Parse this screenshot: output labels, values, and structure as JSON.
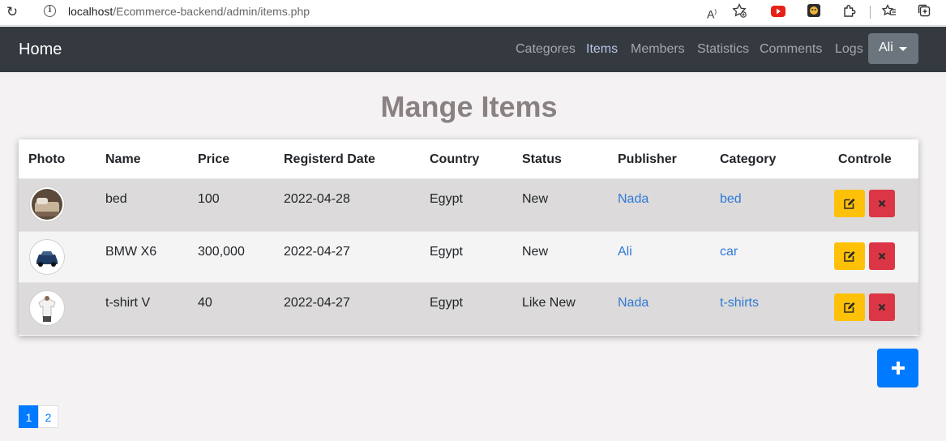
{
  "browser": {
    "url_host": "localhost",
    "url_path": "/Ecommerce-backend/admin/items.php",
    "read_aloud_label": "A",
    "read_aloud_sup": ")"
  },
  "navbar": {
    "brand": "Home",
    "links": [
      {
        "label": "Categores"
      },
      {
        "label": "Items",
        "active": true
      },
      {
        "label": "Members"
      },
      {
        "label": "Statistics"
      },
      {
        "label": "Comments"
      },
      {
        "label": "Logs"
      }
    ],
    "user": "Ali"
  },
  "page_title": "Mange Items",
  "table": {
    "headers": [
      "Photo",
      "Name",
      "Price",
      "Registerd Date",
      "Country",
      "Status",
      "Publisher",
      "Category",
      "Controle"
    ],
    "rows": [
      {
        "name": "bed",
        "price": "100",
        "date": "2022-04-28",
        "country": "Egypt",
        "status": "New",
        "publisher": "Nada",
        "category": "bed"
      },
      {
        "name": "BMW X6",
        "price": "300,000",
        "date": "2022-04-27",
        "country": "Egypt",
        "status": "New",
        "publisher": "Ali",
        "category": "car"
      },
      {
        "name": "t-shirt V",
        "price": "40",
        "date": "2022-04-27",
        "country": "Egypt",
        "status": "Like New",
        "publisher": "Nada",
        "category": "t-shirts"
      }
    ]
  },
  "add_button": {
    "icon": "plus-icon"
  },
  "pagination": {
    "pages": [
      "1",
      "2"
    ],
    "current": "1"
  },
  "colors": {
    "navbar": "#343a40",
    "primary": "#007bff",
    "warning": "#ffc107",
    "danger": "#dc3545",
    "title": "#8a8282",
    "link": "#2e7ad8"
  }
}
